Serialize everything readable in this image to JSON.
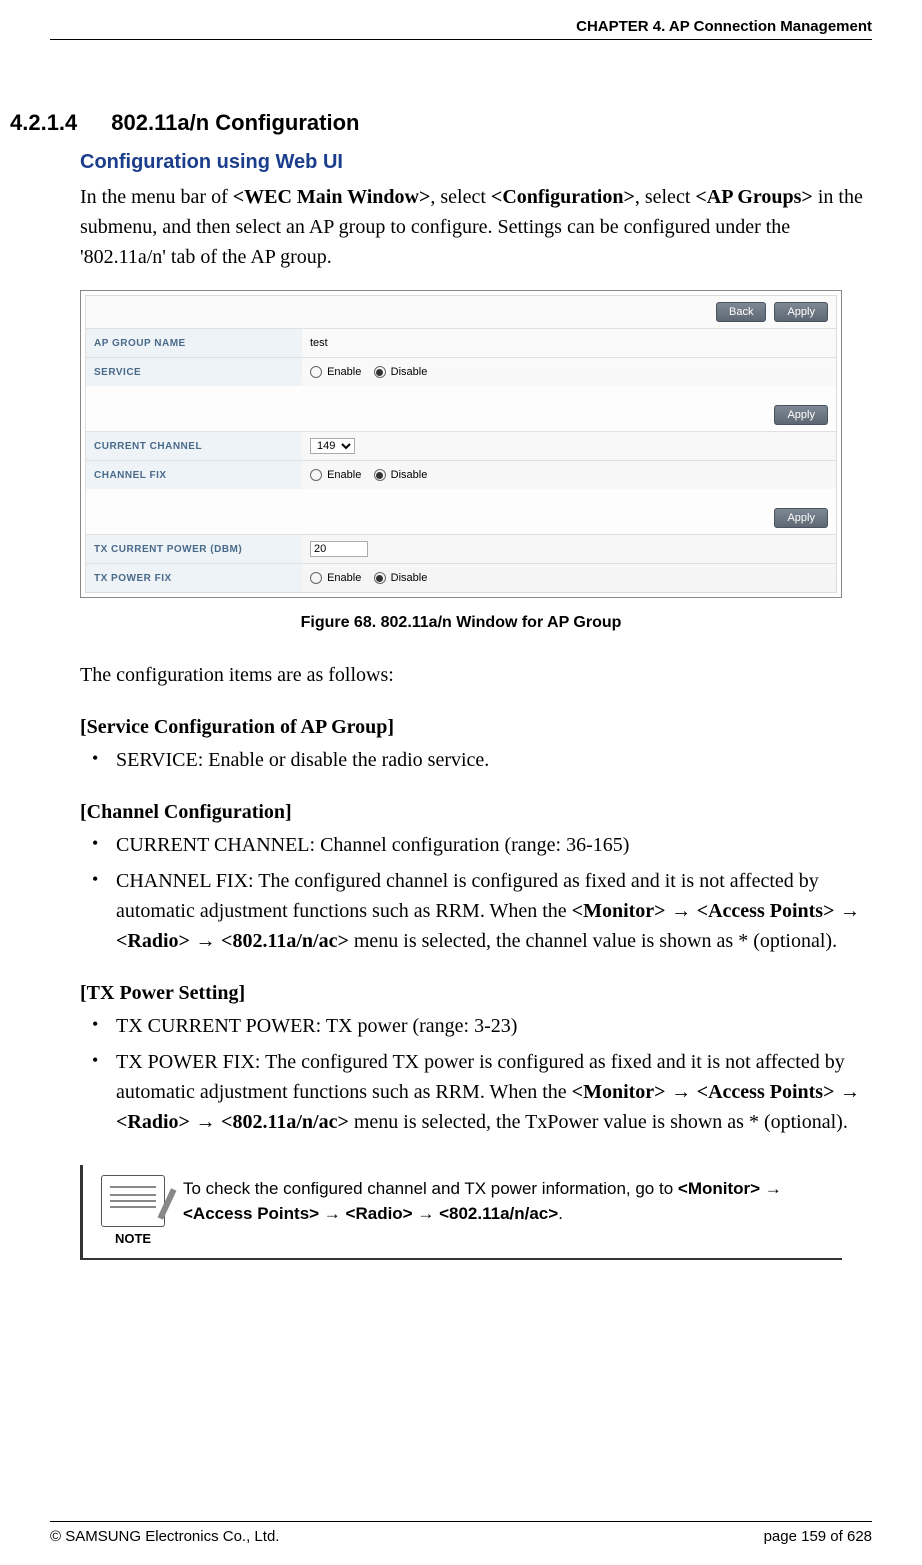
{
  "header": {
    "chapter": "CHAPTER 4. AP Connection Management"
  },
  "section": {
    "number": "4.2.1.4",
    "title": "802.11a/n Configuration"
  },
  "subhead": "Configuration using Web UI",
  "intro": {
    "p1_pre": "In the menu bar of ",
    "p1_b1": "<WEC Main Window>",
    "p1_mid1": ", select ",
    "p1_b2": "<Configuration>",
    "p1_mid2": ", select ",
    "p1_b3": "<AP Groups>",
    "p1_post": " in the submenu, and then select an AP group to configure. Settings can be configured under the '802.11a/n' tab of the AP group."
  },
  "figure": {
    "buttons": {
      "back": "Back",
      "apply": "Apply"
    },
    "rows": {
      "ap_group_name": {
        "label": "AP GROUP NAME",
        "value": "test"
      },
      "service": {
        "label": "SERVICE",
        "enable": "Enable",
        "disable": "Disable"
      },
      "current_channel": {
        "label": "CURRENT CHANNEL",
        "value": "149"
      },
      "channel_fix": {
        "label": "CHANNEL FIX",
        "enable": "Enable",
        "disable": "Disable"
      },
      "tx_current_power": {
        "label": "TX CURRENT POWER (DBM)",
        "value": "20"
      },
      "tx_power_fix": {
        "label": "TX POWER FIX",
        "enable": "Enable",
        "disable": "Disable"
      }
    },
    "caption": "Figure 68. 802.11a/n Window for AP Group"
  },
  "followup": "The configuration items are as follows:",
  "groups": {
    "service": {
      "heading": "[Service Configuration of AP Group]",
      "items": [
        "SERVICE: Enable or disable the radio service."
      ]
    },
    "channel": {
      "heading": "[Channel Configuration]",
      "items": [
        "CURRENT CHANNEL: Channel configuration (range: 36-165)"
      ],
      "item2": {
        "pre": "CHANNEL FIX: The configured channel is configured as fixed and it is not affected by automatic adjustment functions such as RRM. When the ",
        "b1": "<Monitor>",
        "a1": " → ",
        "b2": "<Access Points>",
        "a2": " → ",
        "b3": "<Radio>",
        "a3": " → ",
        "b4": "<802.11a/n/ac>",
        "post": " menu is selected, the channel value is shown as * (optional)."
      }
    },
    "txpower": {
      "heading": "[TX Power Setting]",
      "items": [
        "TX CURRENT POWER: TX power (range: 3-23)"
      ],
      "item2": {
        "pre": "TX POWER FIX: The configured TX power is configured as fixed and it is not affected by automatic adjustment functions such as RRM. When the ",
        "b1": "<Monitor>",
        "a1": " → ",
        "b2": "<Access Points>",
        "a2": " → ",
        "b3": "<Radio>",
        "a3": " → ",
        "b4": "<802.11a/n/ac>",
        "post": " menu is selected, the TxPower value is shown as * (optional)."
      }
    }
  },
  "note": {
    "label": "NOTE",
    "pre": "To check the configured channel and TX power information, go to ",
    "b1": "<Monitor>",
    "a1": " → ",
    "b2": "<Access Points>",
    "a2": " → ",
    "b3": "<Radio>",
    "a3": " → ",
    "b4": "<802.11a/n/ac>",
    "post": "."
  },
  "footer": {
    "copyright": "© SAMSUNG Electronics Co., Ltd.",
    "page": "page 159 of 628"
  }
}
